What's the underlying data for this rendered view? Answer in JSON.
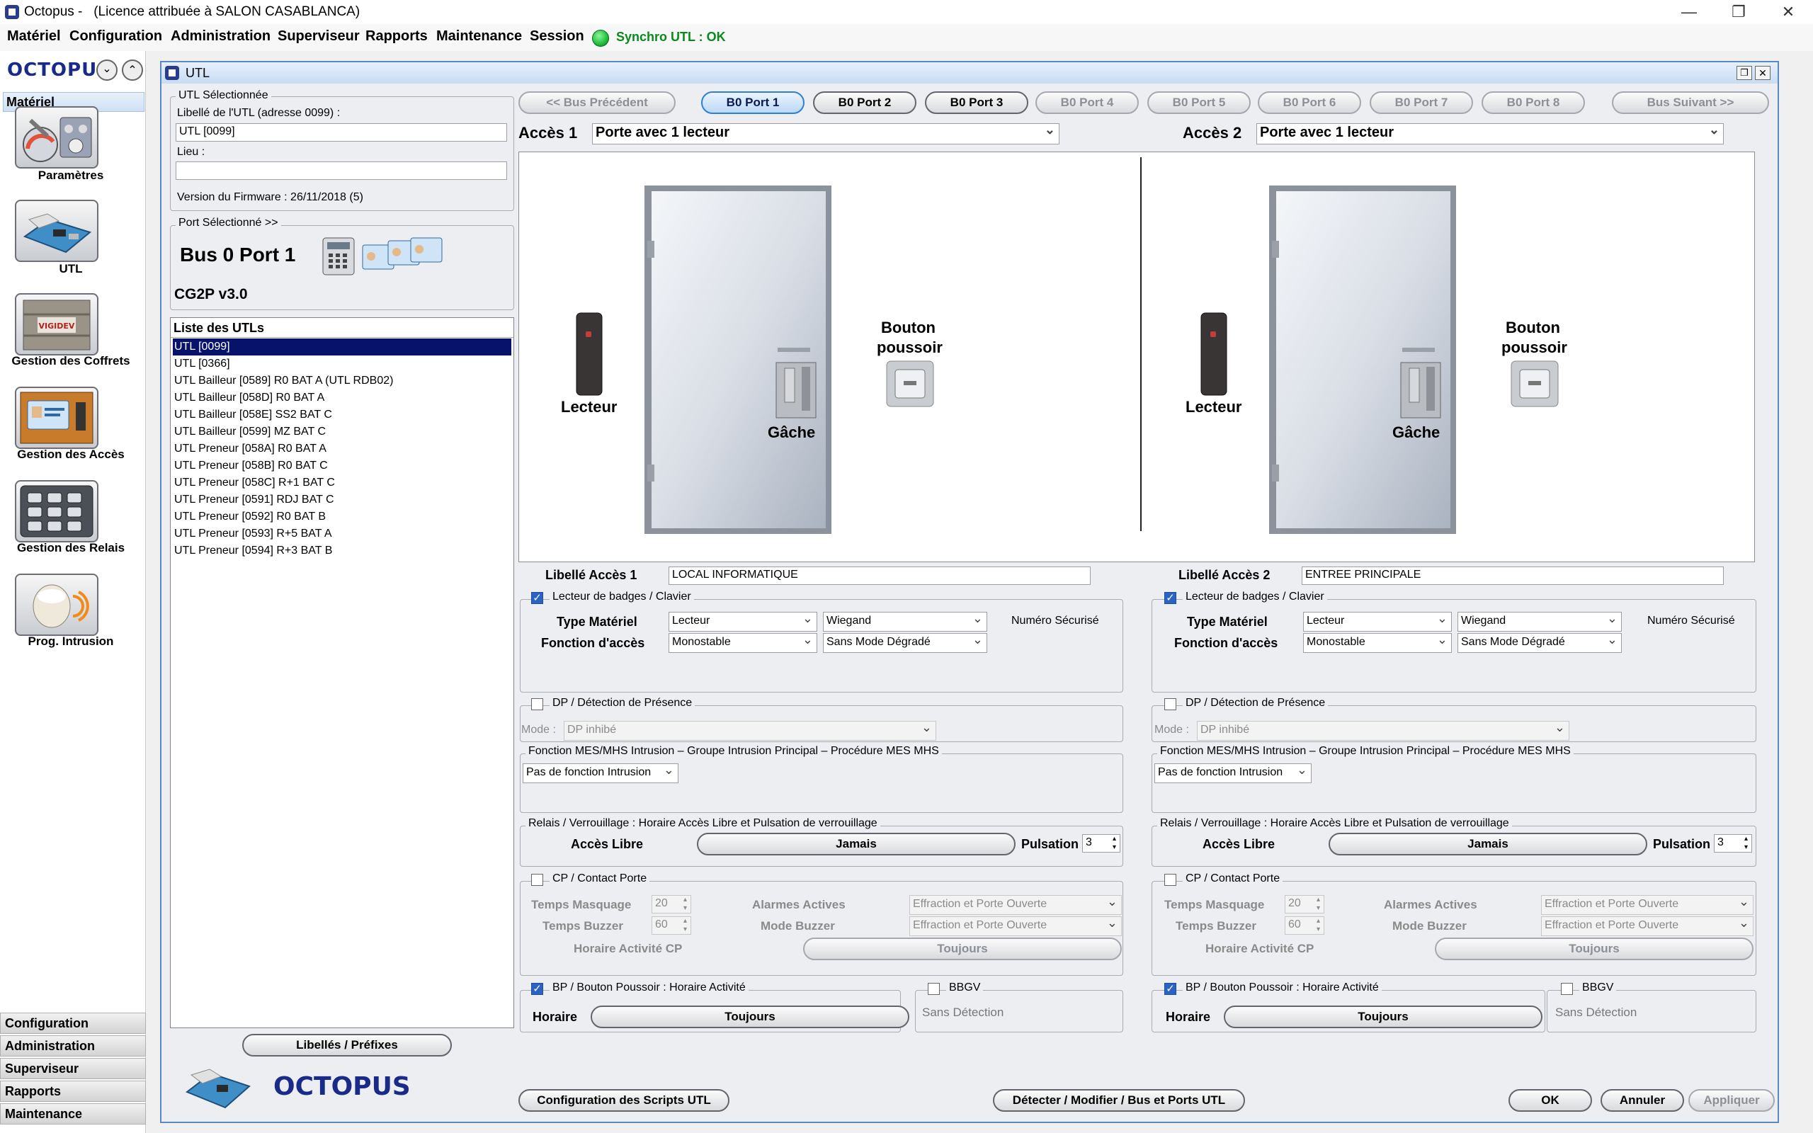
{
  "window": {
    "app": "Octopus -",
    "license": "(Licence attribuée à SALON CASABLANCA)",
    "min": "—",
    "max": "❐",
    "close": "✕"
  },
  "menu": [
    "Matériel",
    "Configuration",
    "Administration",
    "Superviseur",
    "Rapports",
    "Maintenance",
    "Session"
  ],
  "sync": "Synchro UTL : OK",
  "sidebar": {
    "logo": "OCTOPUS",
    "header": "Matériel",
    "tools": [
      "Paramètres",
      "UTL",
      "Gestion des Coffrets",
      "Gestion des Accès",
      "Gestion des Relais",
      "Prog. Intrusion"
    ],
    "bottom": [
      "Configuration",
      "Administration",
      "Superviseur",
      "Rapports",
      "Maintenance"
    ],
    "crate_label": "VIGIDEV"
  },
  "utl": {
    "title": "UTL",
    "selected_group": "UTL Sélectionnée",
    "libelle_label": "Libellé de l'UTL (adresse 0099) :",
    "libelle_value": "UTL [0099]",
    "lieu_label": "Lieu :",
    "lieu_value": "",
    "firmware": "Version du Firmware : 26/11/2018 (5)",
    "port_group": "Port Sélectionné >>",
    "port_name": "Bus 0 Port 1",
    "port_model": "CG2P v3.0",
    "list_title": "Liste des UTLs",
    "list": [
      "UTL [0099]",
      "UTL [0366]",
      "UTL Bailleur [0589] R0 BAT A (UTL RDB02)",
      "UTL Bailleur [058D] R0 BAT A",
      "UTL Bailleur [058E] SS2 BAT C",
      "UTL Bailleur [0599] MZ BAT C",
      "UTL Preneur  [058A] R0 BAT A",
      "UTL Preneur  [058B] R0 BAT C",
      "UTL Preneur  [058C] R+1 BAT C",
      "UTL Preneur  [0591] RDJ BAT C",
      "UTL Preneur  [0592] R0 BAT B",
      "UTL Preneur  [0593] R+5 BAT A",
      "UTL Preneur  [0594] R+3 BAT B"
    ],
    "libelles_btn": "Libellés / Préfixes",
    "footer_logo": "OCTOPUS"
  },
  "ports": {
    "prev": "<< Bus Précédent",
    "next": "Bus Suivant >>",
    "items": [
      "B0 Port 1",
      "B0 Port 2",
      "B0 Port 3",
      "B0 Port 4",
      "B0 Port 5",
      "B0 Port 6",
      "B0 Port 7",
      "B0 Port 8"
    ]
  },
  "access": [
    {
      "label": "Accès 1",
      "type": "Porte avec 1 lecteur",
      "reader": "Lecteur",
      "strike": "Gâche",
      "push1": "Bouton",
      "push2": "poussoir",
      "libelle_label": "Libellé Accès 1",
      "libelle": "LOCAL INFORMATIQUE",
      "badge_grp": "Lecteur de badges / Clavier",
      "type_mat_lbl": "Type Matériel",
      "type_mat": "Lecteur",
      "protocol": "Wiegand",
      "secure": "Numéro Sécurisé",
      "fonction_lbl": "Fonction d'accès",
      "fonction": "Monostable",
      "degrade": "Sans Mode Dégradé",
      "dp_grp": "DP / Détection de Présence",
      "mode_lbl": "Mode :",
      "mode": "DP inhibé",
      "mes_grp": "Fonction MES/MHS Intrusion  –  Groupe Intrusion Principal   –   Procédure MES MHS",
      "mes": "Pas de fonction Intrusion",
      "relais_grp": "Relais / Verrouillage : Horaire Accès Libre et Pulsation de verrouillage",
      "acces_libre_lbl": "Accès Libre",
      "acces_libre": "Jamais",
      "pulsation_lbl": "Pulsation",
      "pulsation": "3",
      "cp_grp": "CP / Contact Porte",
      "tm_lbl": "Temps Masquage",
      "tm": "20",
      "tb_lbl": "Temps Buzzer",
      "tb": "60",
      "aa_lbl": "Alarmes Actives",
      "aa": "Effraction et Porte Ouverte",
      "mb_lbl": "Mode Buzzer",
      "mb": "Effraction et Porte Ouverte",
      "hcp_lbl": "Horaire Activité CP",
      "hcp": "Toujours",
      "bp_grp": "BP / Bouton Poussoir : Horaire Activité",
      "horaire_lbl": "Horaire",
      "horaire": "Toujours",
      "bbgv": "BBGV",
      "bbgv_val": "Sans Détection"
    },
    {
      "label": "Accès 2",
      "type": "Porte avec 1 lecteur",
      "reader": "Lecteur",
      "strike": "Gâche",
      "push1": "Bouton",
      "push2": "poussoir",
      "libelle_label": "Libellé Accès 2",
      "libelle": "ENTREE PRINCIPALE",
      "badge_grp": "Lecteur de badges / Clavier",
      "type_mat_lbl": "Type Matériel",
      "type_mat": "Lecteur",
      "protocol": "Wiegand",
      "secure": "Numéro Sécurisé",
      "fonction_lbl": "Fonction d'accès",
      "fonction": "Monostable",
      "degrade": "Sans Mode Dégradé",
      "dp_grp": "DP / Détection de Présence",
      "mode_lbl": "Mode :",
      "mode": "DP inhibé",
      "mes_grp": "Fonction MES/MHS Intrusion  –  Groupe Intrusion Principal   –   Procédure MES MHS",
      "mes": "Pas de fonction Intrusion",
      "relais_grp": "Relais / Verrouillage : Horaire Accès Libre et Pulsation de verrouillage",
      "acces_libre_lbl": "Accès Libre",
      "acces_libre": "Jamais",
      "pulsation_lbl": "Pulsation",
      "pulsation": "3",
      "cp_grp": "CP / Contact Porte",
      "tm_lbl": "Temps Masquage",
      "tm": "20",
      "tb_lbl": "Temps Buzzer",
      "tb": "60",
      "aa_lbl": "Alarmes Actives",
      "aa": "Effraction et Porte Ouverte",
      "mb_lbl": "Mode Buzzer",
      "mb": "Effraction et Porte Ouverte",
      "hcp_lbl": "Horaire Activité CP",
      "hcp": "Toujours",
      "bp_grp": "BP / Bouton Poussoir : Horaire Activité",
      "horaire_lbl": "Horaire",
      "horaire": "Toujours",
      "bbgv": "BBGV",
      "bbgv_val": "Sans Détection"
    }
  ],
  "footer": {
    "scripts": "Configuration des Scripts UTL",
    "detect": "Détecter / Modifier / Bus et Ports UTL",
    "ok": "OK",
    "cancel": "Annuler",
    "apply": "Appliquer"
  },
  "colors": {
    "accent": "#2e7ed6",
    "selection": "#07126b",
    "sync_ok": "#1fbf3a",
    "sync_text": "#0a8a1e"
  }
}
